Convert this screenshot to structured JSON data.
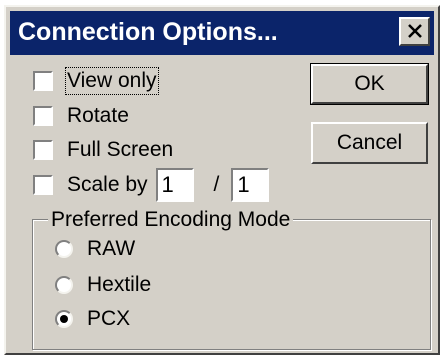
{
  "window": {
    "title": "Connection Options...",
    "close_glyph": "X"
  },
  "options": {
    "view_only": {
      "label": "View only",
      "checked": false
    },
    "rotate": {
      "label": "Rotate",
      "checked": false
    },
    "full_screen": {
      "label": "Full Screen",
      "checked": false
    },
    "scale_by": {
      "label": "Scale by",
      "checked": false,
      "numerator": "1",
      "separator": "/",
      "denominator": "1"
    }
  },
  "buttons": {
    "ok": "OK",
    "cancel": "Cancel"
  },
  "encoding": {
    "group_label": "Preferred Encoding Mode",
    "modes": [
      {
        "label": "RAW",
        "selected": false
      },
      {
        "label": "Hextile",
        "selected": false
      },
      {
        "label": "PCX",
        "selected": true
      }
    ]
  }
}
